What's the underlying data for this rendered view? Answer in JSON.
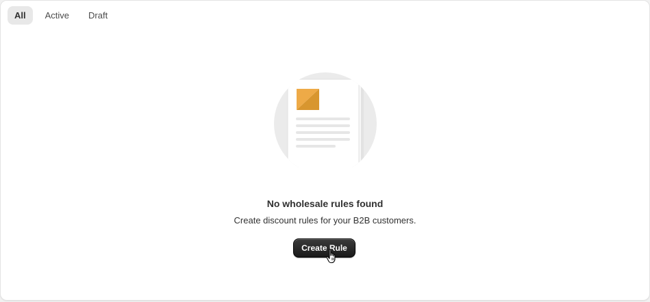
{
  "tabs": [
    {
      "label": "All",
      "selected": true
    },
    {
      "label": "Active",
      "selected": false
    },
    {
      "label": "Draft",
      "selected": false
    }
  ],
  "empty_state": {
    "illustration": "document-icon",
    "title": "No wholesale rules found",
    "description": "Create discount rules for your B2B customers.",
    "cta_label": "Create Rule"
  },
  "colors": {
    "accent_square": "#e3a13d",
    "button_bg": "#1f1f1f",
    "selected_tab_bg": "#e8e8e8"
  },
  "cursor": "hand-pointer-icon"
}
